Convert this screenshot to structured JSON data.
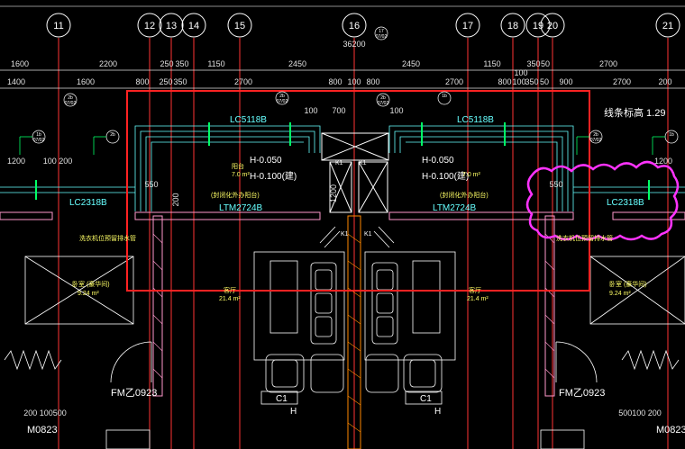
{
  "axes": [
    "11",
    "12",
    "13",
    "14",
    "15",
    "16",
    "17",
    "18",
    "19",
    "20",
    "21"
  ],
  "top_dims": [
    "1600",
    "2200",
    "250",
    "350",
    "1150",
    "2450",
    "2450",
    "1150",
    "100",
    "350",
    "50",
    "2700"
  ],
  "top_dim_2": [
    "1400",
    "1600",
    "800",
    "250",
    "350",
    "2700",
    "800",
    "100",
    "800",
    "2700",
    "800",
    "100",
    "350",
    "50",
    "900",
    "2700",
    "200"
  ],
  "axis16_tag": "36200",
  "labels": {
    "lc_left": "LC5118B",
    "lc_right": "LC5118B",
    "ltm_left": "LTM2724B",
    "ltm_right": "LTM2724B",
    "lc_far_left": "LC2318B",
    "lc_far_right": "LC2318B",
    "h1_left": "H-0.050",
    "h2_left": "H-0.100(建)",
    "h1_right": "H-0.050",
    "h2_right": "H-0.100(建)",
    "balcony_left": "阳台",
    "balcony_left_area": "7.0 m²",
    "balcony_right_area": "7.0 m²",
    "balcony_left_note": "(封闭化外办阳台)",
    "balcony_right_note": "(封闭化外办阳台)",
    "living_left": "客厅",
    "living_right": "客厅",
    "living_left_area": "21.4 m²",
    "living_right_area": "21.4 m²",
    "bed_left": "卧室 (豪华间)",
    "bed_right": "卧室 (豪华间)",
    "bed_left_area": "9.24 m²",
    "bed_right_area": "9.24 m²",
    "fm_left": "FM乙0923",
    "fm_right": "FM乙0923",
    "m_left": "M0823",
    "m_right": "M0823",
    "c1_left": "C1",
    "c1_right": "C1",
    "h_left": "H",
    "h_right": "H",
    "elev_right": "线条标高 1.29",
    "k1a": "K1",
    "k1b": "K1",
    "k1c": "K1",
    "k1d": "K1",
    "bottom_dims_left": "200 100500",
    "bottom_dims_right": "500100 200",
    "dim_1200": "1200",
    "dim_100_200": "100 200",
    "dim_1200r": "1200",
    "dim_550_l": "550",
    "dim_550_r": "550",
    "dim_200": "200",
    "dim_100": "100",
    "dim_1200v": "1200",
    "dim_700": "700",
    "dim_100b": "100",
    "sub_tags": [
      "2b",
      "2b",
      "2b",
      "1b",
      "1b",
      "2b",
      "2b",
      "1b",
      "1b",
      "17"
    ],
    "sub_tag_code": "07/02",
    "red_note_left": "洗衣机位预留排水管",
    "red_note_right": "洗衣机位预留排水管"
  },
  "colors": {
    "axis_line": "#ff3333",
    "frame_red": "#ff2222",
    "wall_cyan": "#66ffff",
    "hatch_pink": "#ff99cc",
    "dim_white": "#e0e0e0",
    "magenta_cloud": "#ff33ff",
    "green": "#00ff66",
    "yellow": "#ffff00"
  }
}
